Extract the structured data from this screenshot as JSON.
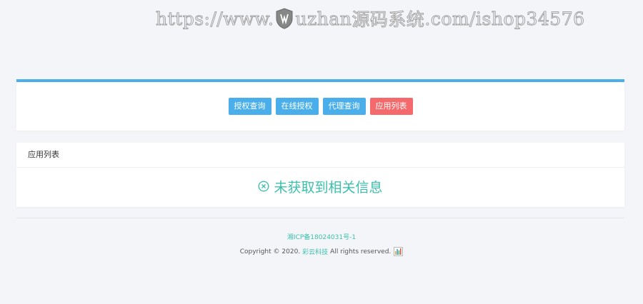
{
  "watermark": {
    "prefix": "https://www.",
    "middle": "uzhan",
    "cn": "源码系统",
    "suffix": ".com/ishop34576"
  },
  "nav": {
    "buttons": [
      {
        "label": "授权查询",
        "color": "#4aaeea"
      },
      {
        "label": "在线授权",
        "color": "#4aaeea"
      },
      {
        "label": "代理查询",
        "color": "#4aaeea"
      },
      {
        "label": "应用列表",
        "color": "#f4696b"
      }
    ]
  },
  "list": {
    "title": "应用列表",
    "empty_message": "未获取到相关信息",
    "empty_icon": "circle-x-icon"
  },
  "footer": {
    "icp": "湘ICP备18024031号-1",
    "copyright_prefix": "Copyright © 2020.",
    "company": "彩云科技",
    "rights": "All rights reserved.",
    "stats_icon": "bar-chart-icon"
  },
  "colors": {
    "primary": "#4aaeea",
    "danger": "#f4696b",
    "accent_green": "#3cc0ac",
    "background": "#f4f5f9"
  }
}
